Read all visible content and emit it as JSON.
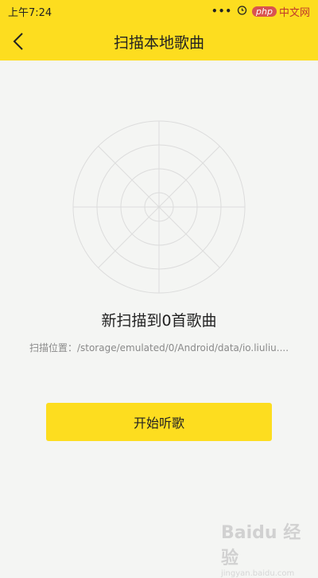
{
  "status_bar": {
    "time": "上午7:24",
    "dots": "•••",
    "watermark_php": "php",
    "watermark_text": "中文网"
  },
  "header": {
    "title": "扫描本地歌曲"
  },
  "scan": {
    "result_text": "新扫描到0首歌曲",
    "path_text": "扫描位置：/storage/emulated/0/Android/data/io.liuliu...."
  },
  "actions": {
    "start_label": "开始听歌"
  },
  "watermark": {
    "brand": "Baidu 经验",
    "sub": "jingyan.baidu.com"
  },
  "colors": {
    "accent": "#fddd1f",
    "background": "#f4f5f3",
    "radar_line": "#dcdcdc"
  },
  "icons": {
    "back": "chevron-left-icon",
    "radar": "radar-icon"
  }
}
